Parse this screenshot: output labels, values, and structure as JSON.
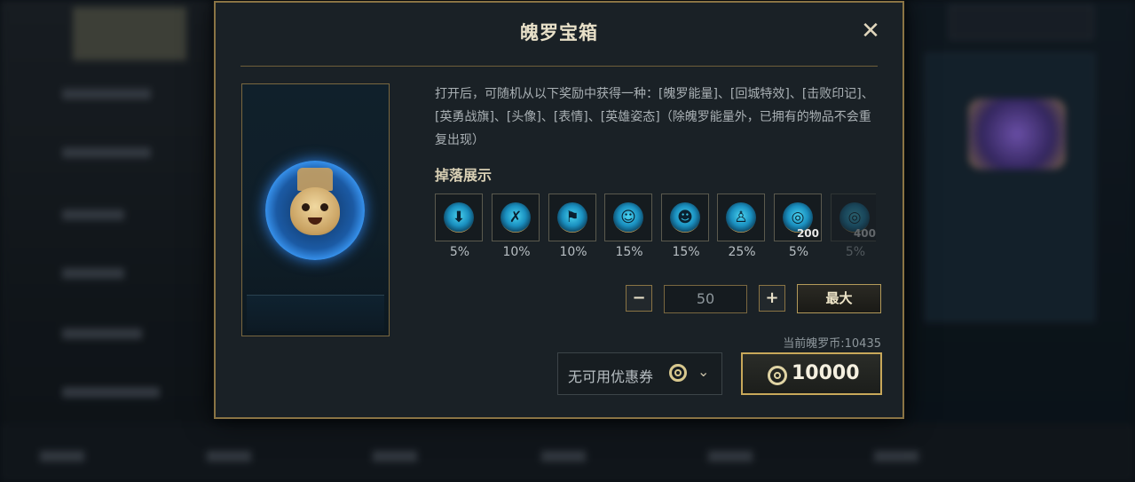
{
  "modal": {
    "title": "魄罗宝箱",
    "close_label": "✕",
    "description": "打开后，可随机从以下奖励中获得一种：[魄罗能量]、[回城特效]、[击败印记]、[英勇战旗]、[头像]、[表情]、[英雄姿态]（除魄罗能量外，已拥有的物品不会重复出现）",
    "drop_title": "掉落展示",
    "drops": [
      {
        "icon": "recall-effect-icon",
        "glyph": "⬇",
        "percent": "5%",
        "qty": ""
      },
      {
        "icon": "kill-mark-icon",
        "glyph": "✗",
        "percent": "10%",
        "qty": ""
      },
      {
        "icon": "banner-icon",
        "glyph": "⚑",
        "percent": "10%",
        "qty": ""
      },
      {
        "icon": "avatar-icon",
        "glyph": "☺",
        "percent": "15%",
        "qty": ""
      },
      {
        "icon": "emote-icon",
        "glyph": "☻",
        "percent": "15%",
        "qty": ""
      },
      {
        "icon": "champion-pose-icon",
        "glyph": "♙",
        "percent": "25%",
        "qty": ""
      },
      {
        "icon": "poro-energy-icon",
        "glyph": "◎",
        "percent": "5%",
        "qty": "200"
      },
      {
        "icon": "poro-energy-icon",
        "glyph": "◎",
        "percent": "5%",
        "qty": "400"
      }
    ],
    "quantity": {
      "minus": "−",
      "value": "50",
      "plus": "+",
      "max_label": "最大"
    },
    "balance_text": "当前魄罗币:10435",
    "coupon_label": "无可用优惠券",
    "price": "10000"
  },
  "colors": {
    "gold_border": "#8a7444",
    "panel": "#1a2126",
    "accent_blue": "#3ea0ff"
  }
}
